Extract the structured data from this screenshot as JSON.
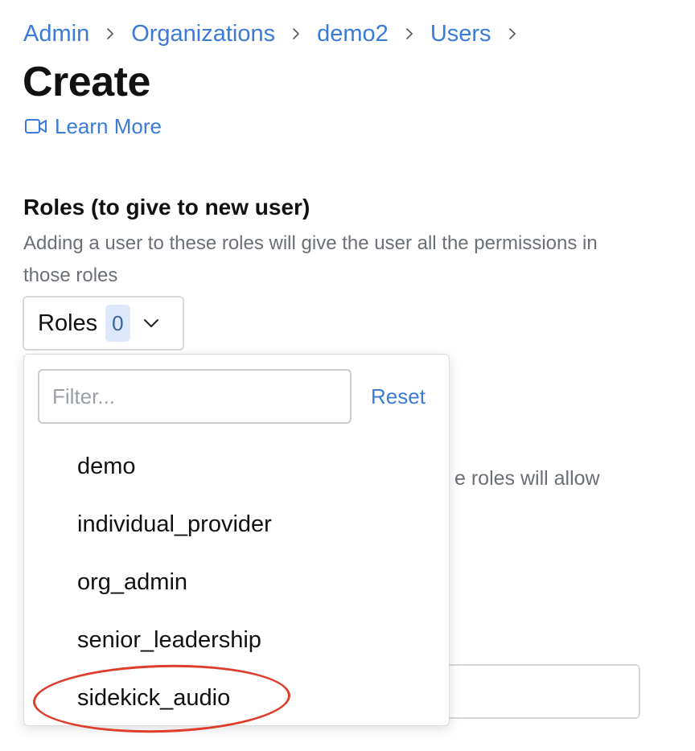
{
  "breadcrumb": {
    "items": [
      "Admin",
      "Organizations",
      "demo2",
      "Users"
    ]
  },
  "page": {
    "title": "Create",
    "learn_more": "Learn More",
    "learn_more_icon": "video-camera-icon"
  },
  "roles_section": {
    "title": "Roles (to give to new user)",
    "description": "Adding a user to these roles will give the user all the permissions in those roles",
    "button_label": "Roles",
    "selected_count": "0"
  },
  "background": {
    "partial_text": "e roles will allow"
  },
  "roles_dropdown": {
    "filter_placeholder": "Filter...",
    "reset_label": "Reset",
    "options": [
      "demo",
      "individual_provider",
      "org_admin",
      "senior_leadership",
      "sidekick_audio"
    ]
  },
  "colors": {
    "link": "#3b7bd8",
    "badge_bg": "#dde9fb",
    "annotation": "#df3d2c",
    "muted_text": "#6b6f76"
  }
}
